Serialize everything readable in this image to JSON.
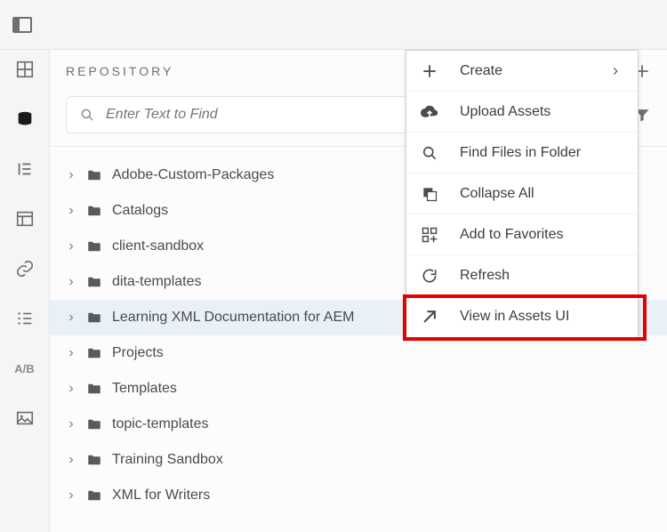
{
  "top_rail": {
    "icon": "panel-left-icon"
  },
  "left_rail": {
    "items": [
      {
        "name": "grid-icon",
        "active": false
      },
      {
        "name": "database-icon",
        "active": true
      },
      {
        "name": "outline-icon",
        "active": false
      },
      {
        "name": "layout-icon",
        "active": false
      },
      {
        "name": "link-icon",
        "active": false
      },
      {
        "name": "list-icon",
        "active": false
      },
      {
        "name": "ab-icon",
        "active": false
      },
      {
        "name": "image-icon",
        "active": false
      }
    ]
  },
  "panel": {
    "title": "REPOSITORY",
    "add_button": "add-icon",
    "search": {
      "placeholder": "Enter Text to Find"
    },
    "filter_button": "filter-icon"
  },
  "tree": {
    "items": [
      {
        "label": "Adobe-Custom-Packages",
        "selected": false
      },
      {
        "label": "Catalogs",
        "selected": false
      },
      {
        "label": "client-sandbox",
        "selected": false
      },
      {
        "label": "dita-templates",
        "selected": false
      },
      {
        "label": "Learning XML Documentation for AEM",
        "selected": true
      },
      {
        "label": "Projects",
        "selected": false
      },
      {
        "label": "Templates",
        "selected": false
      },
      {
        "label": "topic-templates",
        "selected": false
      },
      {
        "label": "Training Sandbox",
        "selected": false
      },
      {
        "label": "XML for Writers",
        "selected": false
      }
    ]
  },
  "context_menu": {
    "items": [
      {
        "label": "Create",
        "name": "create",
        "icon": "plus-icon",
        "submenu": true,
        "highlighted": false
      },
      {
        "label": "Upload Assets",
        "name": "upload-assets",
        "icon": "upload-icon",
        "submenu": false,
        "highlighted": false
      },
      {
        "label": "Find Files in Folder",
        "name": "find-files",
        "icon": "search-icon",
        "submenu": false,
        "highlighted": false
      },
      {
        "label": "Collapse All",
        "name": "collapse-all",
        "icon": "collapse-icon",
        "submenu": false,
        "highlighted": false
      },
      {
        "label": "Add to Favorites",
        "name": "add-favorites",
        "icon": "grid-add-icon",
        "submenu": false,
        "highlighted": false
      },
      {
        "label": "Refresh",
        "name": "refresh",
        "icon": "refresh-icon",
        "submenu": false,
        "highlighted": false
      },
      {
        "label": "View in Assets UI",
        "name": "view-assets-ui",
        "icon": "open-icon",
        "submenu": false,
        "highlighted": true
      }
    ]
  }
}
